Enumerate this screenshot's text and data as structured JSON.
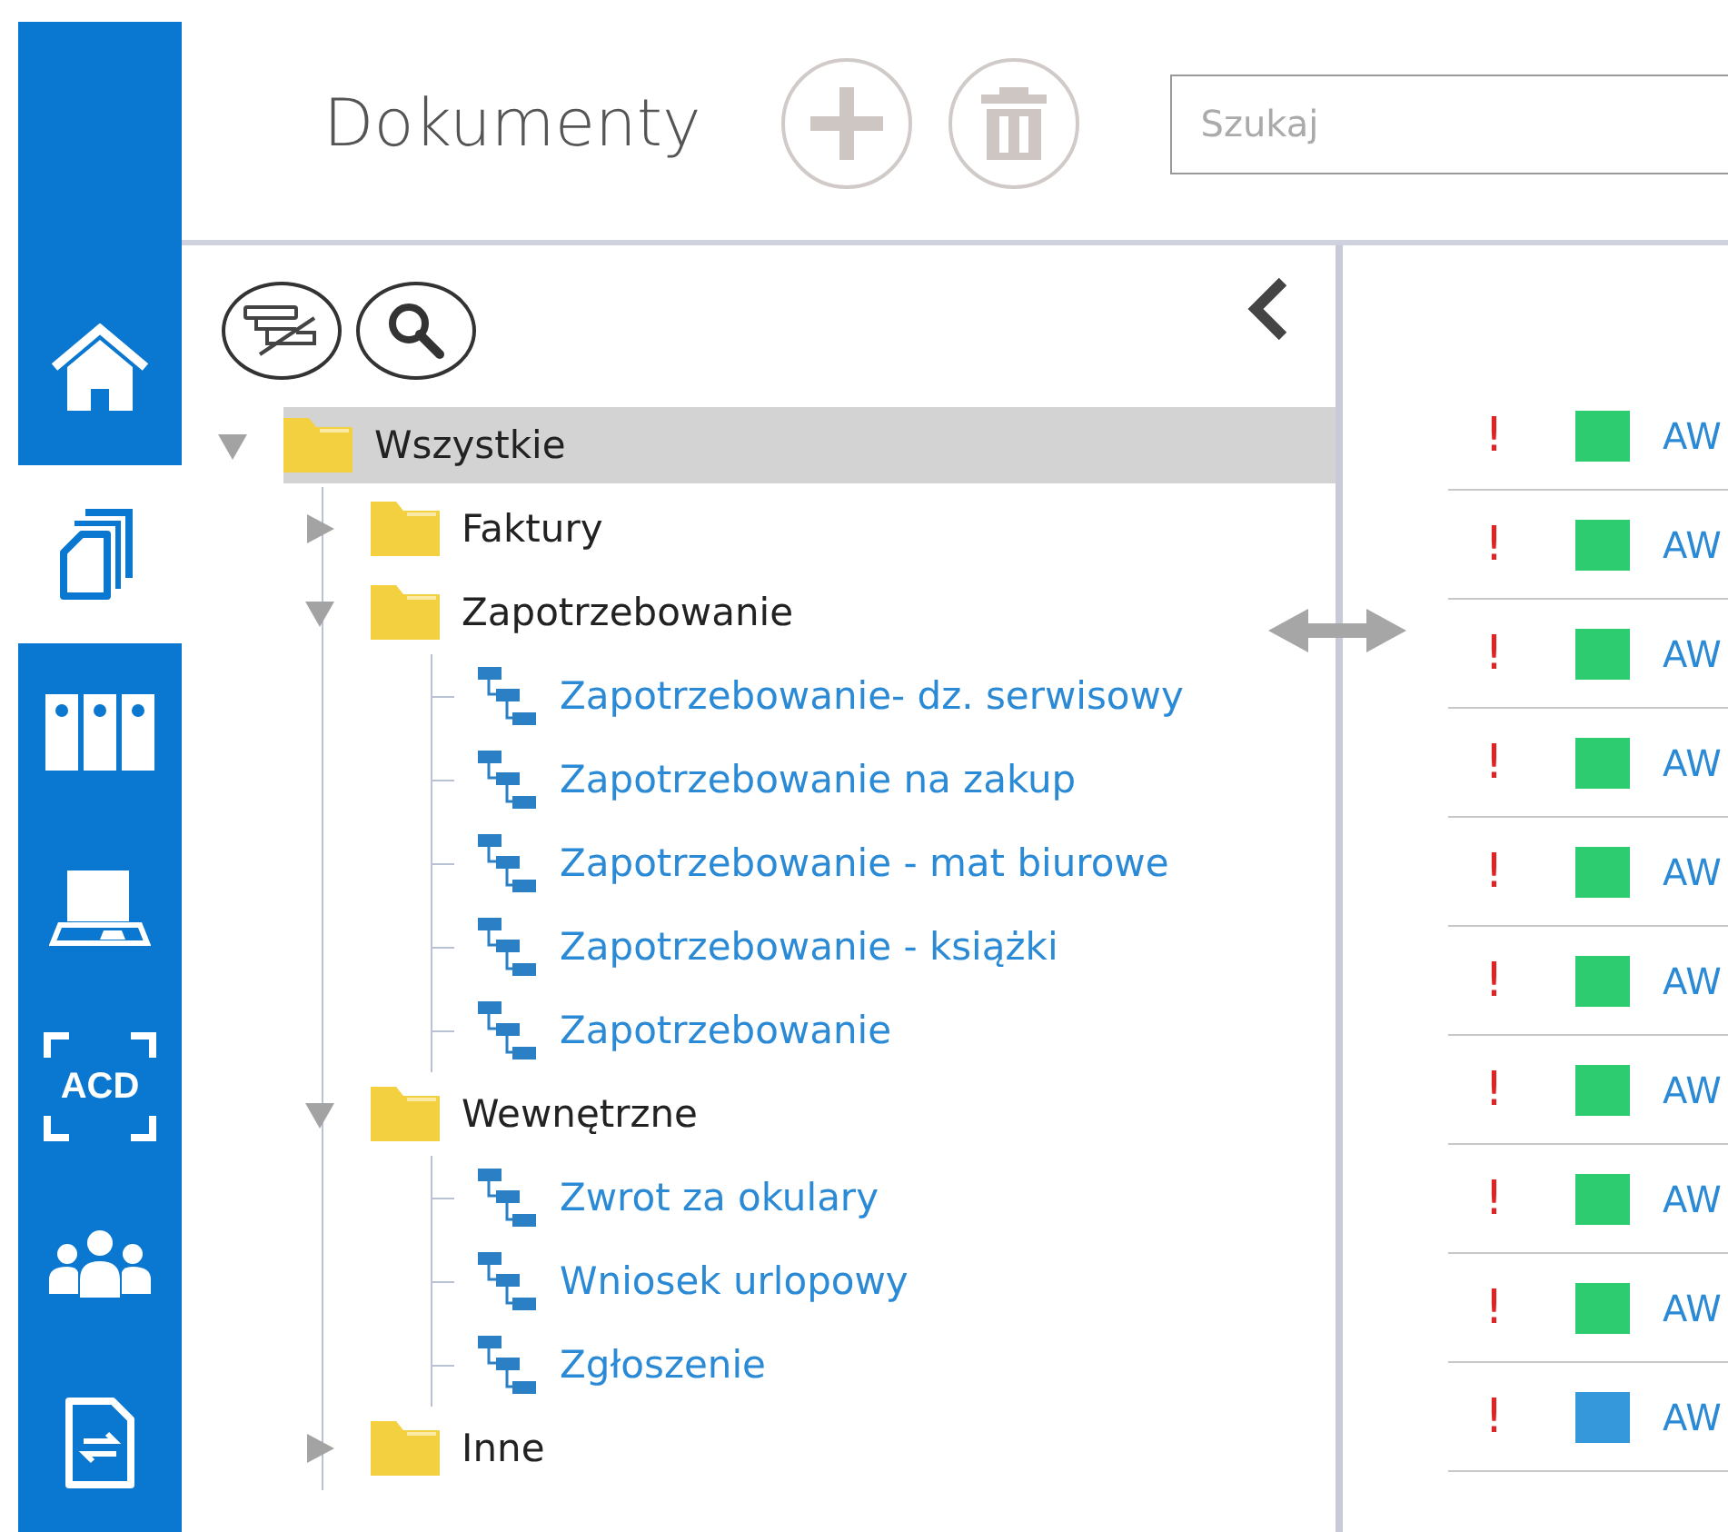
{
  "sidebar": {
    "items": [
      {
        "kind": "home",
        "selected": false
      },
      {
        "kind": "documents",
        "selected": true
      },
      {
        "kind": "binders",
        "selected": false
      },
      {
        "kind": "scanner",
        "selected": false
      },
      {
        "kind": "acd",
        "label": "ACD",
        "selected": false
      },
      {
        "kind": "users",
        "selected": false
      },
      {
        "kind": "sync",
        "selected": false
      }
    ]
  },
  "header": {
    "title": "Dokumenty",
    "search": {
      "placeholder": "Szukaj"
    }
  },
  "tree": {
    "nodes": [
      {
        "label": "Wszystkie",
        "kind": "folder",
        "expanded": true,
        "selected": true,
        "children": [
          {
            "label": "Faktury",
            "kind": "folder",
            "expanded": false,
            "selected": false
          },
          {
            "label": "Zapotrzebowanie",
            "kind": "folder",
            "expanded": true,
            "selected": false,
            "children": [
              {
                "label": "Zapotrzebowanie- dz. serwisowy",
                "kind": "process",
                "selected": false
              },
              {
                "label": "Zapotrzebowanie na zakup",
                "kind": "process",
                "selected": false
              },
              {
                "label": "Zapotrzebowanie - mat biurowe",
                "kind": "process",
                "selected": false
              },
              {
                "label": "Zapotrzebowanie - książki",
                "kind": "process",
                "selected": false
              },
              {
                "label": "Zapotrzebowanie",
                "kind": "process",
                "selected": false
              }
            ]
          },
          {
            "label": "Wewnętrzne",
            "kind": "folder",
            "expanded": true,
            "selected": false,
            "children": [
              {
                "label": "Zwrot za okulary",
                "kind": "process",
                "selected": false
              },
              {
                "label": "Wniosek urlopowy",
                "kind": "process",
                "selected": false
              },
              {
                "label": "Zgłoszenie",
                "kind": "process",
                "selected": false
              }
            ]
          },
          {
            "label": "Inne",
            "kind": "folder",
            "expanded": false,
            "selected": false
          }
        ]
      }
    ]
  },
  "documents": {
    "rows": [
      {
        "flag": "!",
        "color": "#2ecc71",
        "name": "AW"
      },
      {
        "flag": "!",
        "color": "#2ecc71",
        "name": "AW"
      },
      {
        "flag": "!",
        "color": "#2ecc71",
        "name": "AW"
      },
      {
        "flag": "!",
        "color": "#2ecc71",
        "name": "AW"
      },
      {
        "flag": "!",
        "color": "#2ecc71",
        "name": "AW"
      },
      {
        "flag": "!",
        "color": "#2ecc71",
        "name": "AW"
      },
      {
        "flag": "!",
        "color": "#2ecc71",
        "name": "AW"
      },
      {
        "flag": "!",
        "color": "#2ecc71",
        "name": "AW"
      },
      {
        "flag": "!",
        "color": "#2ecc71",
        "name": "AW"
      },
      {
        "flag": "!",
        "color": "#3498db",
        "name": "AW"
      }
    ]
  }
}
